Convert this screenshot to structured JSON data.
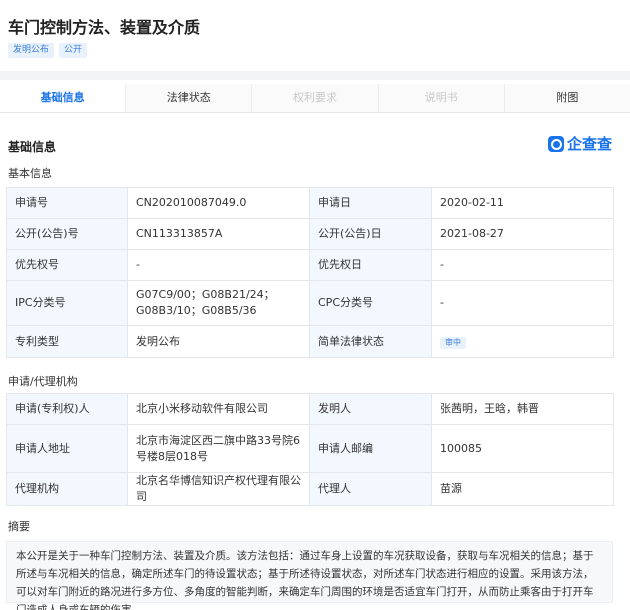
{
  "title": "车门控制方法、装置及介质",
  "tags": [
    "发明公布",
    "公开"
  ],
  "tabs": {
    "basic": "基础信息",
    "legal": "法律状态",
    "claims": "权利要求",
    "description": "说明书",
    "drawings": "附图"
  },
  "section_title": "基础信息",
  "brand": "企查查",
  "basic": {
    "title": "基本信息",
    "app_no_label": "申请号",
    "app_no": "CN202010087049.0",
    "app_date_label": "申请日",
    "app_date": "2020-02-11",
    "pub_no_label": "公开(公告)号",
    "pub_no": "CN113313857A",
    "pub_date_label": "公开(公告)日",
    "pub_date": "2021-08-27",
    "priority_no_label": "优先权号",
    "priority_no": "-",
    "priority_date_label": "优先权日",
    "priority_date": "-",
    "ipc_label": "IPC分类号",
    "ipc": "G07C9/00；G08B21/24；G08B3/10；G08B5/36",
    "cpc_label": "CPC分类号",
    "cpc": "-",
    "patent_type_label": "专利类型",
    "patent_type": "发明公布",
    "legal_status_label": "简单法律状态",
    "legal_status": "审中"
  },
  "agency": {
    "title": "申请/代理机构",
    "applicant_label": "申请(专利权)人",
    "applicant": "北京小米移动软件有限公司",
    "inventor_label": "发明人",
    "inventor": "张茜明，王晗，韩晋",
    "address_label": "申请人地址",
    "address": "北京市海淀区西二旗中路33号院6号楼8层018号",
    "postcode_label": "申请人邮编",
    "postcode": "100085",
    "agency_label": "代理机构",
    "agency": "北京名华博信知识产权代理有限公司",
    "agent_label": "代理人",
    "agent": "苗源"
  },
  "abstract": {
    "title": "摘要",
    "text": "本公开是关于一种车门控制方法、装置及介质。该方法包括：通过车身上设置的车况获取设备，获取与车况相关的信息；基于所述与车况相关的信息，确定所述车门的待设置状态；基于所述待设置状态，对所述车门状态进行相应的设置。采用该方法，可以对车门附近的路况进行多方位、多角度的智能判断，来确定车门周围的环境是否适宜车门打开，从而防止乘客由于打开车门造成人身或车辆的伤害。"
  }
}
